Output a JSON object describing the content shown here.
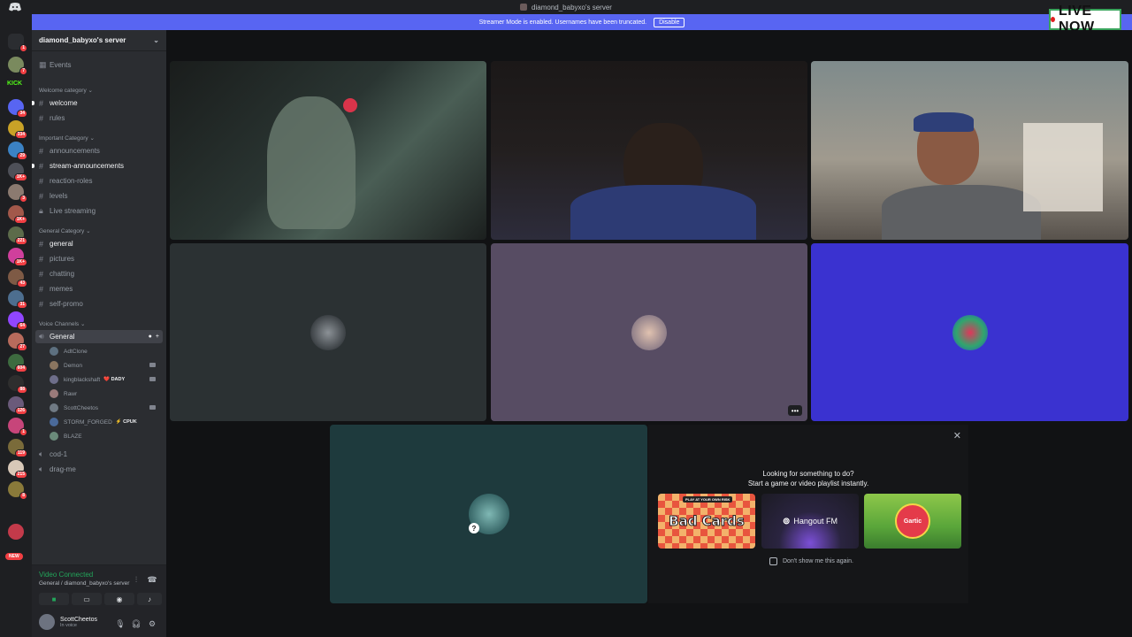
{
  "window": {
    "title": "diamond_babyxo's server"
  },
  "streamer_bar": {
    "message": "Streamer Mode is enabled. Usernames have been truncated.",
    "disable_label": "Disable"
  },
  "overlay": {
    "live_label": "LIVE NOW"
  },
  "guilds": {
    "badges": [
      "1",
      "7",
      "34",
      "334",
      "29",
      "1K+",
      "3",
      "1K+",
      "221",
      "1K+",
      "43",
      "31",
      "64",
      "27",
      "604",
      "88",
      "126",
      "1",
      "119",
      "215",
      "8"
    ],
    "new_label": "NEW",
    "kick_label": "KICK"
  },
  "server": {
    "name": "diamond_babyxo's server",
    "events_label": "Events"
  },
  "categories": {
    "welcome": "Welcome category",
    "important": "Important Category",
    "general": "General Category",
    "voice": "Voice Channels"
  },
  "channels": {
    "welcome": "welcome",
    "rules": "rules",
    "announcements": "announcements",
    "stream_announcements": "stream-announcements",
    "reaction_roles": "reaction-roles",
    "levels": "levels",
    "live_streaming": "Live streaming",
    "general": "general",
    "pictures": "pictures",
    "chatting": "chatting",
    "memes": "memes",
    "self_promo": "self-promo",
    "voice_general": "General",
    "cod": "cod-1",
    "drag": "drag-me"
  },
  "voice_users": [
    {
      "name": "AdtClone",
      "tag": "",
      "camera": false
    },
    {
      "name": "Demon",
      "tag": "",
      "camera": true
    },
    {
      "name": "kingblackshaft",
      "tag": "❤️ DADY",
      "camera": true
    },
    {
      "name": "Rawr",
      "tag": "",
      "camera": false
    },
    {
      "name": "ScottCheetos",
      "tag": "",
      "camera": true
    },
    {
      "name": "STORM_FORGED",
      "tag": "⚡ CPUK",
      "camera": false
    },
    {
      "name": "BLAZE",
      "tag": "",
      "camera": false
    }
  ],
  "voice_panel": {
    "status": "Video Connected",
    "location": "General / diamond_babyxo's server",
    "username": "ScottCheetos",
    "user_status": "In voice"
  },
  "activity": {
    "title_line1": "Looking for something to do?",
    "title_line2": "Start a game or video playlist instantly.",
    "cards": [
      "Bad Cards",
      "Hangout FM",
      "Gartic"
    ],
    "card1_tagline": "PLAY AT YOUR OWN RISK",
    "dont_show": "Don't show me this again."
  },
  "colors": {
    "brand": "#5865f2",
    "online": "#23a55a",
    "mention": "#f23f43"
  }
}
